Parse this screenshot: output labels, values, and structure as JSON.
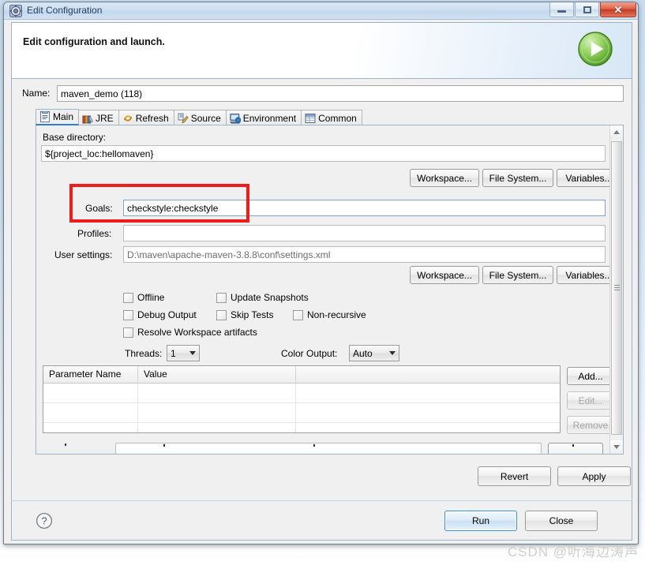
{
  "window": {
    "title": "Edit Configuration",
    "icon": "config-gear-icon",
    "minimize_label": "Minimize",
    "maximize_label": "Maximize",
    "close_label": "Close"
  },
  "header": {
    "title": "Edit configuration and launch.",
    "badge_icon": "run-play-icon"
  },
  "name_row": {
    "label": "Name:",
    "value": "maven_demo (118)",
    "placeholder": ""
  },
  "tabs": [
    {
      "label": "Main",
      "icon": "main-document-icon",
      "active": true
    },
    {
      "label": "JRE",
      "icon": "jre-library-icon",
      "active": false
    },
    {
      "label": "Refresh",
      "icon": "refresh-arrows-icon",
      "active": false
    },
    {
      "label": "Source",
      "icon": "source-pencil-icon",
      "active": false
    },
    {
      "label": "Environment",
      "icon": "environment-icon",
      "active": false
    },
    {
      "label": "Common",
      "icon": "common-table-icon",
      "active": false
    }
  ],
  "main_tab": {
    "base_directory": {
      "label": "Base directory:",
      "value": "${project_loc:hellomaven}"
    },
    "base_dir_buttons": [
      "Workspace...",
      "File System...",
      "Variables..."
    ],
    "goals": {
      "label": "Goals:",
      "value": "checkstyle:checkstyle",
      "highlighted": true
    },
    "profiles": {
      "label": "Profiles:",
      "value": ""
    },
    "user_settings": {
      "label": "User settings:",
      "value": "D:\\maven\\apache-maven-3.8.8\\conf\\settings.xml"
    },
    "user_settings_buttons": [
      "Workspace...",
      "File System...",
      "Variables..."
    ],
    "checkboxes": [
      {
        "label": "Offline",
        "checked": false
      },
      {
        "label": "Update Snapshots",
        "checked": false
      },
      {
        "label": "Debug Output",
        "checked": false
      },
      {
        "label": "Skip Tests",
        "checked": false
      },
      {
        "label": "Non-recursive",
        "checked": false
      },
      {
        "label": "Resolve Workspace artifacts",
        "checked": false
      }
    ],
    "threads": {
      "label": "Threads:",
      "value": "1"
    },
    "color_output": {
      "label": "Color Output:",
      "value": "Auto"
    },
    "parameter_table": {
      "columns": [
        "Parameter Name",
        "Value",
        ""
      ],
      "rows": [
        [
          "",
          "",
          ""
        ],
        [
          "",
          "",
          ""
        ],
        [
          "",
          "",
          ""
        ]
      ]
    },
    "table_buttons": [
      {
        "label": "Add...",
        "enabled": true
      },
      {
        "label": "Edit...",
        "enabled": false
      },
      {
        "label": "Remove",
        "enabled": false
      }
    ]
  },
  "apply_bar": {
    "revert_label": "Revert",
    "apply_label": "Apply"
  },
  "footer": {
    "help_icon": "help-question-icon",
    "run_label": "Run",
    "close_label": "Close"
  },
  "watermark": "CSDN @听海边涛声",
  "colors": {
    "accent_blue": "#2f7fd0",
    "highlight_red": "#ef1c1c",
    "titlebar_blue": "#cfe0f1",
    "close_red": "#c53b22",
    "run_green": "#6cbb3c"
  }
}
